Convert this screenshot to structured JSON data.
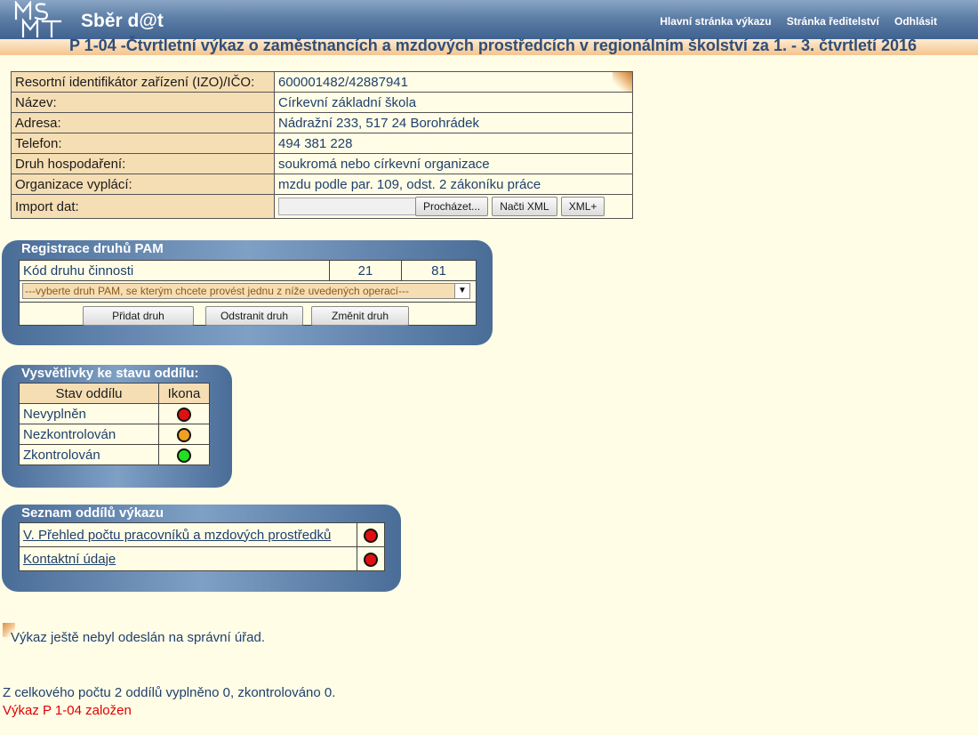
{
  "header": {
    "brand": "Sběr d@t",
    "nav": [
      "Hlavní stránka výkazu",
      "Stránka ředitelství",
      "Odhlásit"
    ],
    "title": "P 1-04 -Čtvrtletní výkaz o zaměstnancích a mzdových prostředcích v regionálním školství za 1. - 3. čtvrtletí 2016"
  },
  "info": [
    {
      "label": "Resortní identifikátor zařízení (IZO)/IČO:",
      "value": "600001482/42887941"
    },
    {
      "label": "Název:",
      "value": "Církevní základní škola"
    },
    {
      "label": "Adresa:",
      "value": "Nádražní 233, 517 24 Borohrádek"
    },
    {
      "label": "Telefon:",
      "value": "494 381 228"
    },
    {
      "label": "Druh hospodaření:",
      "value": "soukromá nebo církevní organizace"
    },
    {
      "label": "Organizace vyplácí:",
      "value": "mzdu podle par. 109, odst. 2 zákoníku práce"
    }
  ],
  "import": {
    "label": "Import dat:",
    "browse": "Procházet...",
    "load_xml": "Načti XML",
    "xml_plus": "XML+"
  },
  "pam": {
    "title": "Registrace druhů PAM",
    "code_label": "Kód druhu činnosti",
    "code1": "21",
    "code2": "81",
    "select_placeholder": "---vyberte druh PAM, se kterým chcete provést jednu z níže uvedených operací---",
    "add": "Přidat druh",
    "remove": "Odstranit druh",
    "change": "Změnit druh"
  },
  "legend": {
    "title": "Vysvětlivky ke stavu oddílu:",
    "col_state": "Stav oddílu",
    "col_icon": "Ikona",
    "rows": [
      {
        "state": "Nevyplněn",
        "color": "#e01010"
      },
      {
        "state": "Nezkontrolován",
        "color": "#f0a020"
      },
      {
        "state": "Zkontrolován",
        "color": "#20e020"
      }
    ]
  },
  "sections": {
    "title": "Seznam oddílů výkazu",
    "items": [
      {
        "label": "V. Přehled počtu pracovníků a mzdových prostředků",
        "color": "#e01010"
      },
      {
        "label": "Kontaktní údaje",
        "color": "#e01010"
      }
    ]
  },
  "status": {
    "not_sent": "Výkaz ještě nebyl odeslán na správní úřad.",
    "summary": "Z celkového počtu 2 oddílů vyplněno 0, zkontrolováno 0.",
    "created": "Výkaz P 1-04 založen",
    "created_color": "#e00000"
  }
}
